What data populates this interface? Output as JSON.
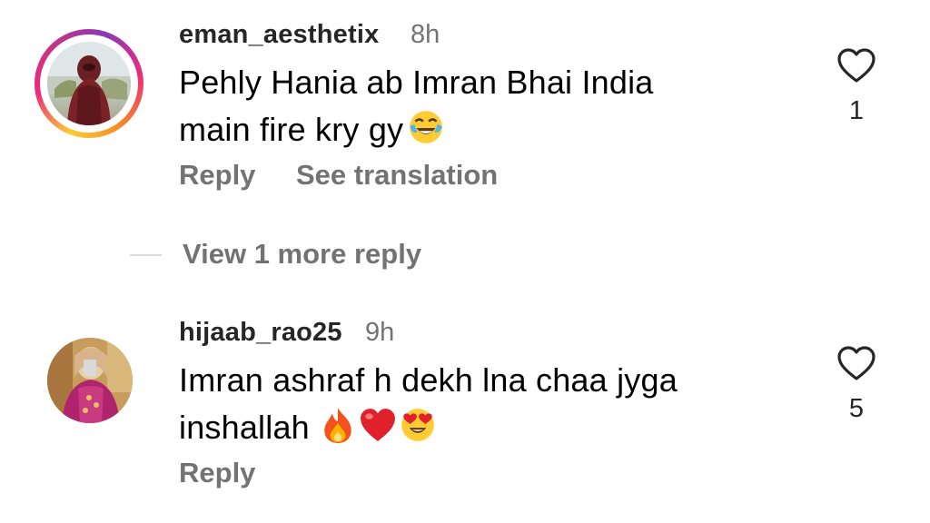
{
  "comments": [
    {
      "username": "eman_aesthetix",
      "time": "8h",
      "text_line1": "Pehly Hania ab Imran Bhai India",
      "text_line2": "main fire kry gy",
      "emojis": [
        "face-with-tears-of-joy"
      ],
      "reply_label": "Reply",
      "translate_label": "See translation",
      "likes": "1",
      "has_story_ring": true
    },
    {
      "username": "hijaab_rao25",
      "time": "9h",
      "text_line1": "Imran ashraf h dekh lna chaa jyga",
      "text_line2": "inshallah",
      "emojis": [
        "fire",
        "red-heart",
        "smiling-face-with-heart-eyes"
      ],
      "reply_label": "Reply",
      "likes": "5",
      "has_story_ring": false
    }
  ],
  "view_more_replies": "View 1 more reply",
  "icons": {
    "like": "heart-outline-icon"
  },
  "colors": {
    "username": "#262626",
    "secondary_text": "#737373",
    "icon_stroke": "#262626"
  }
}
